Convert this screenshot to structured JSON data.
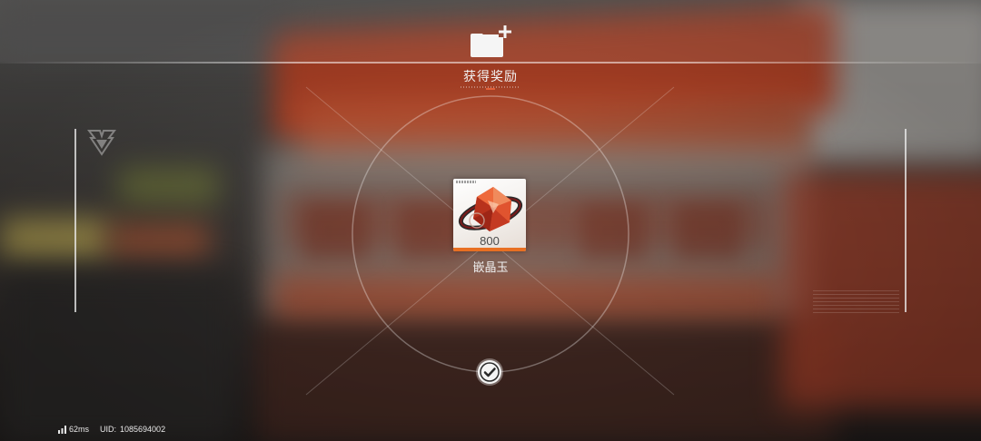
{
  "header": {
    "icon": "reward-box-icon",
    "title": "获得奖励"
  },
  "reward": {
    "icon": "crystal-gem-icon",
    "count": "800",
    "name": "嵌晶玉"
  },
  "confirm": {
    "icon": "checkmark-icon"
  },
  "footer": {
    "latency": "62ms",
    "uid_label": "UID:",
    "uid_value": "1085694002"
  },
  "colors": {
    "accent": "#e86f22",
    "confirm_bg": "#f4f4f4"
  }
}
